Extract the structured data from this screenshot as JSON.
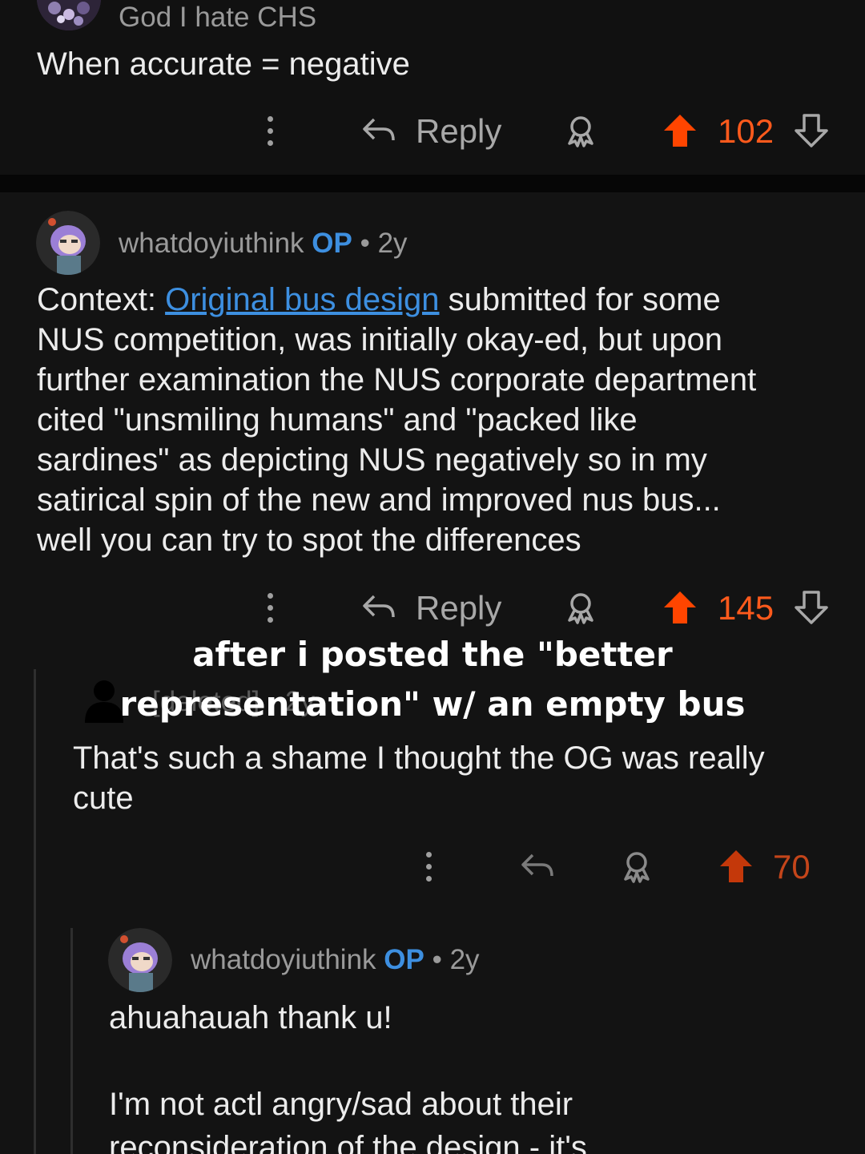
{
  "comments": [
    {
      "username": "God I hate CHS",
      "body": "When accurate = negative",
      "reply_label": "Reply",
      "score": "102"
    },
    {
      "username": "whatdoyiuthink",
      "op_badge": "OP",
      "separator": "•",
      "age": "2y",
      "body_link": "Original bus design",
      "body_prefix": "Context: ",
      "body_lines": [
        " submitted for some",
        "NUS competition, was initially okay-ed, but upon",
        "further examination the NUS corporate department",
        "cited \"unsmiling humans\" and \"packed like",
        "sardines\" as depicting NUS negatively so in my",
        "satirical spin of the new and improved nus bus...",
        "well you can try to spot the differences"
      ],
      "reply_label": "Reply",
      "score": "145"
    },
    {
      "username": "[deleted]",
      "separator": "•",
      "age": "2y",
      "body_lines": [
        "That's such a shame I thought the OG was really",
        "cute"
      ],
      "score": "70"
    },
    {
      "username": "whatdoyiuthink",
      "op_badge": "OP",
      "separator": "•",
      "age": "2y",
      "body_lines": [
        "ahuahauah thank u!",
        "",
        "I'm not actl angry/sad about their",
        "reconsideration of the design - it's"
      ]
    }
  ],
  "overlay_caption": {
    "line1": "after i posted the \"better",
    "line2": "representation\" w/ an empty bus"
  },
  "colors": {
    "background": "#131313",
    "upvote": "#ff4500",
    "op_badge": "#3d8fe0",
    "link": "#3d8fe0"
  },
  "icons": [
    "kebab-menu-icon",
    "reply-arrow-icon",
    "award-icon",
    "upvote-icon",
    "downvote-icon",
    "deleted-user-icon"
  ]
}
